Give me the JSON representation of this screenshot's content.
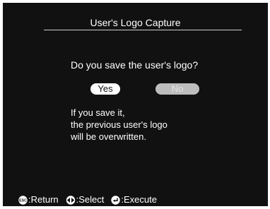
{
  "dialog": {
    "title": "User's Logo Capture",
    "question": "Do you save the user's logo?",
    "yes_label": "Yes",
    "no_label": "No",
    "message_lines": [
      "If you save it,",
      "the previous user's logo",
      "will be overwritten."
    ]
  },
  "footer": {
    "return_label": ":Return",
    "select_label": ":Select",
    "execute_label": ":Execute",
    "esc_icon_text": "ESC"
  },
  "colors": {
    "background": "#111111",
    "text": "#ffffff",
    "selected_button": "#ffffff",
    "unselected_button": "#bdbdbd"
  },
  "selected_option": "Yes"
}
